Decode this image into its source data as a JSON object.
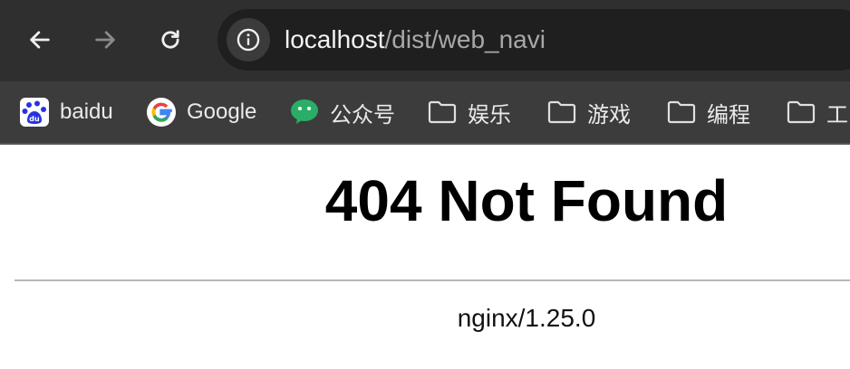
{
  "browser": {
    "nav": {
      "back_icon": "arrow-left-icon",
      "forward_icon": "arrow-right-icon",
      "reload_icon": "reload-icon"
    },
    "address_bar": {
      "host": "localhost",
      "path": "/dist/web_navi",
      "site_info_icon": "info-icon"
    },
    "bookmarks": [
      {
        "label": "baidu",
        "icon": "baidu-icon"
      },
      {
        "label": "Google",
        "icon": "google-icon"
      },
      {
        "label": "公众号",
        "icon": "wechat-icon"
      },
      {
        "label": "娱乐",
        "icon": "folder-icon"
      },
      {
        "label": "游戏",
        "icon": "folder-icon"
      },
      {
        "label": "编程",
        "icon": "folder-icon"
      },
      {
        "label": "工",
        "icon": "folder-icon"
      }
    ]
  },
  "page": {
    "title": "404 Not Found",
    "server": "nginx/1.25.0"
  }
}
